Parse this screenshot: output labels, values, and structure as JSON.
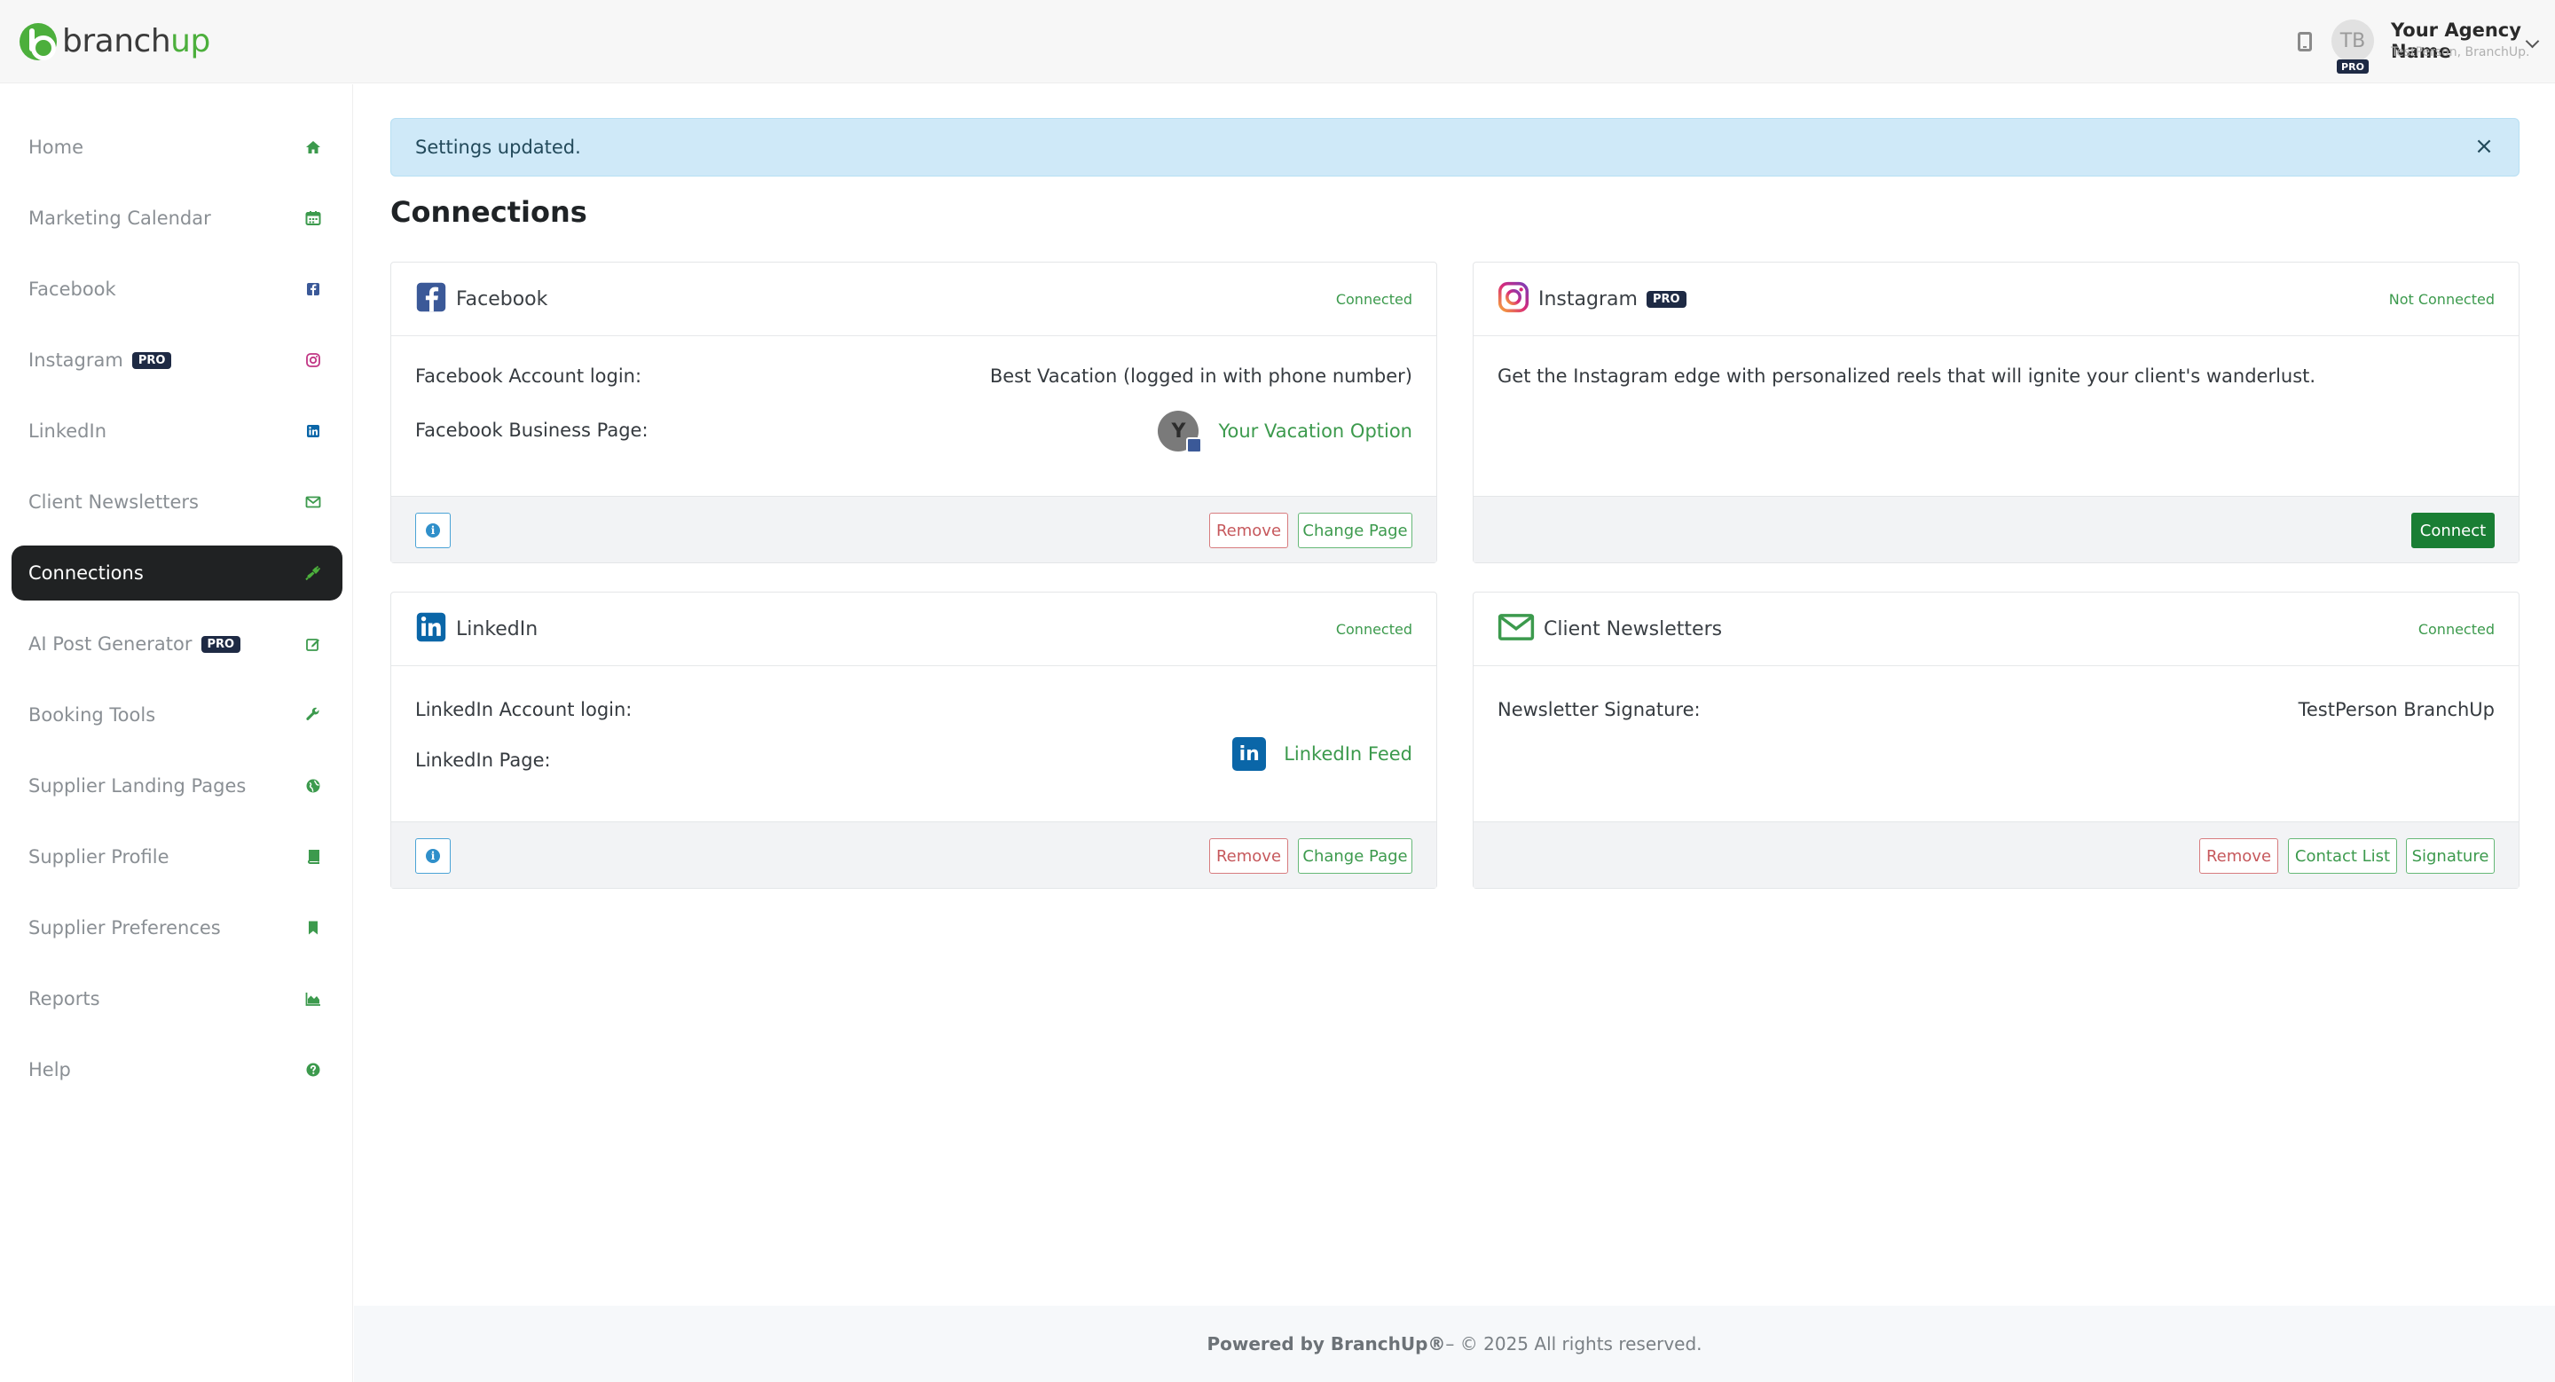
{
  "header": {
    "logo_part1": "branch",
    "logo_part2": "up",
    "avatar_initials": "TB",
    "pro_badge": "PRO",
    "agency_name": "Your Agency Name",
    "agency_sub": "TestPerson, BranchUp."
  },
  "sidebar": {
    "pro_badge": "PRO",
    "items": [
      {
        "label": "Home",
        "icon": "home-icon"
      },
      {
        "label": "Marketing Calendar",
        "icon": "calendar-icon"
      },
      {
        "label": "Facebook",
        "icon": "facebook-icon"
      },
      {
        "label": "Instagram",
        "icon": "instagram-icon",
        "pro": true
      },
      {
        "label": "LinkedIn",
        "icon": "linkedin-icon"
      },
      {
        "label": "Client Newsletters",
        "icon": "envelope-icon"
      },
      {
        "label": "Connections",
        "icon": "plug-icon",
        "active": true
      },
      {
        "label": "AI Post Generator",
        "icon": "edit-icon",
        "pro": true
      },
      {
        "label": "Booking Tools",
        "icon": "wrench-icon"
      },
      {
        "label": "Supplier Landing Pages",
        "icon": "globe-icon"
      },
      {
        "label": "Supplier Profile",
        "icon": "book-icon"
      },
      {
        "label": "Supplier Preferences",
        "icon": "bookmark-icon"
      },
      {
        "label": "Reports",
        "icon": "area-chart-icon"
      },
      {
        "label": "Help",
        "icon": "question-circle-icon"
      }
    ]
  },
  "alert": {
    "message": "Settings updated.",
    "close": "×"
  },
  "page_title": "Connections",
  "cards": {
    "facebook": {
      "title": "Facebook",
      "status": "Connected",
      "account_label": "Facebook Account login:",
      "account_value": "Best Vacation (logged in with phone number)",
      "page_label": "Facebook Business Page:",
      "page_avatar": "Y",
      "page_value": "Your Vacation Option",
      "remove": "Remove",
      "change_page": "Change Page"
    },
    "instagram": {
      "title": "Instagram",
      "pro": "PRO",
      "status": "Not Connected",
      "description": "Get the Instagram edge with personalized reels that will ignite your client's wanderlust.",
      "connect": "Connect"
    },
    "linkedin": {
      "title": "LinkedIn",
      "status": "Connected",
      "account_label": "LinkedIn Account login:",
      "page_label": "LinkedIn Page:",
      "page_badge": "in",
      "page_value": "LinkedIn Feed",
      "remove": "Remove",
      "change_page": "Change Page"
    },
    "newsletters": {
      "title": "Client Newsletters",
      "status": "Connected",
      "signature_label": "Newsletter Signature:",
      "signature_value": "TestPerson BranchUp",
      "remove": "Remove",
      "contact_list": "Contact List",
      "signature": "Signature"
    }
  },
  "footer": {
    "brand": "Powered by BranchUp®",
    "rest": " – © 2025 All rights reserved."
  },
  "colors": {
    "accent_green": "#3c9a4d",
    "active_nav": "#202223",
    "alert_bg": "#cfe9f8",
    "pro_badge": "#1e2a44"
  }
}
